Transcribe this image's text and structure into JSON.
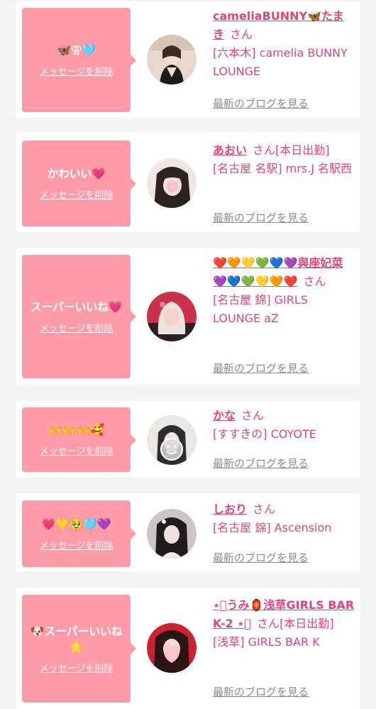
{
  "messages": [
    {
      "reaction": "🦋⚢🩵",
      "delete_label": "メッセージを削除",
      "name": "cameliaBUNNY🦋たまき",
      "honorific": "さん",
      "status": "",
      "shop": "[六本木] camelia BUNNY LOUNGE",
      "blog_label": "最新のブログを見る",
      "avatar_colors": [
        "#3b2b25",
        "#e8d8cc"
      ]
    },
    {
      "reaction": "かわいい💗",
      "delete_label": "メッセージを削除",
      "name": "あおい",
      "honorific": "さん",
      "status": "[本日出勤]",
      "shop": "[名古屋 名駅] mrs.J 名駅西",
      "blog_label": "最新のブログを見る",
      "avatar_colors": [
        "#2b2222",
        "#f1e6e6"
      ]
    },
    {
      "reaction": "スーパーいいね💗",
      "delete_label": "メッセージを削除",
      "name": "❤️🧡💛💚💙💜與座妃菜💜💙💚💛🧡❤️",
      "honorific": "さん",
      "status": "",
      "shop": "[名古屋 錦] GIRLS LOUNGE aZ",
      "blog_label": "最新のブログを見る",
      "avatar_colors": [
        "#c9324a",
        "#f3d3c8"
      ]
    },
    {
      "reaction": "🙌🙌🙌🥰",
      "delete_label": "メッセージを削除",
      "name": "かな",
      "honorific": "さん",
      "status": "",
      "shop": "[すすきの] COYOTE",
      "blog_label": "最新のブログを見る",
      "avatar_colors": [
        "#2d2c2e",
        "#e9e7e3"
      ]
    },
    {
      "reaction": "💗💛🥹🩵💜",
      "delete_label": "メッセージを削除",
      "name": "しおり",
      "honorific": "さん",
      "status": "",
      "shop": "[名古屋 錦] Ascension",
      "blog_label": "最新のブログを見る",
      "avatar_colors": [
        "#1f1c1f",
        "#cdc5c8"
      ]
    },
    {
      "reaction": "🐶スーパーいいね🌟",
      "delete_label": "メッセージを削除",
      "name": "⋆͛うみ🏮浅草GIRLS BAR K-2 ⋆͛",
      "honorific": "さん",
      "status": "[本日出勤]",
      "shop": "[浅草] GIRLS BAR K",
      "blog_label": "最新のブログを見る",
      "avatar_colors": [
        "#2a1414",
        "#c8232f"
      ]
    }
  ]
}
